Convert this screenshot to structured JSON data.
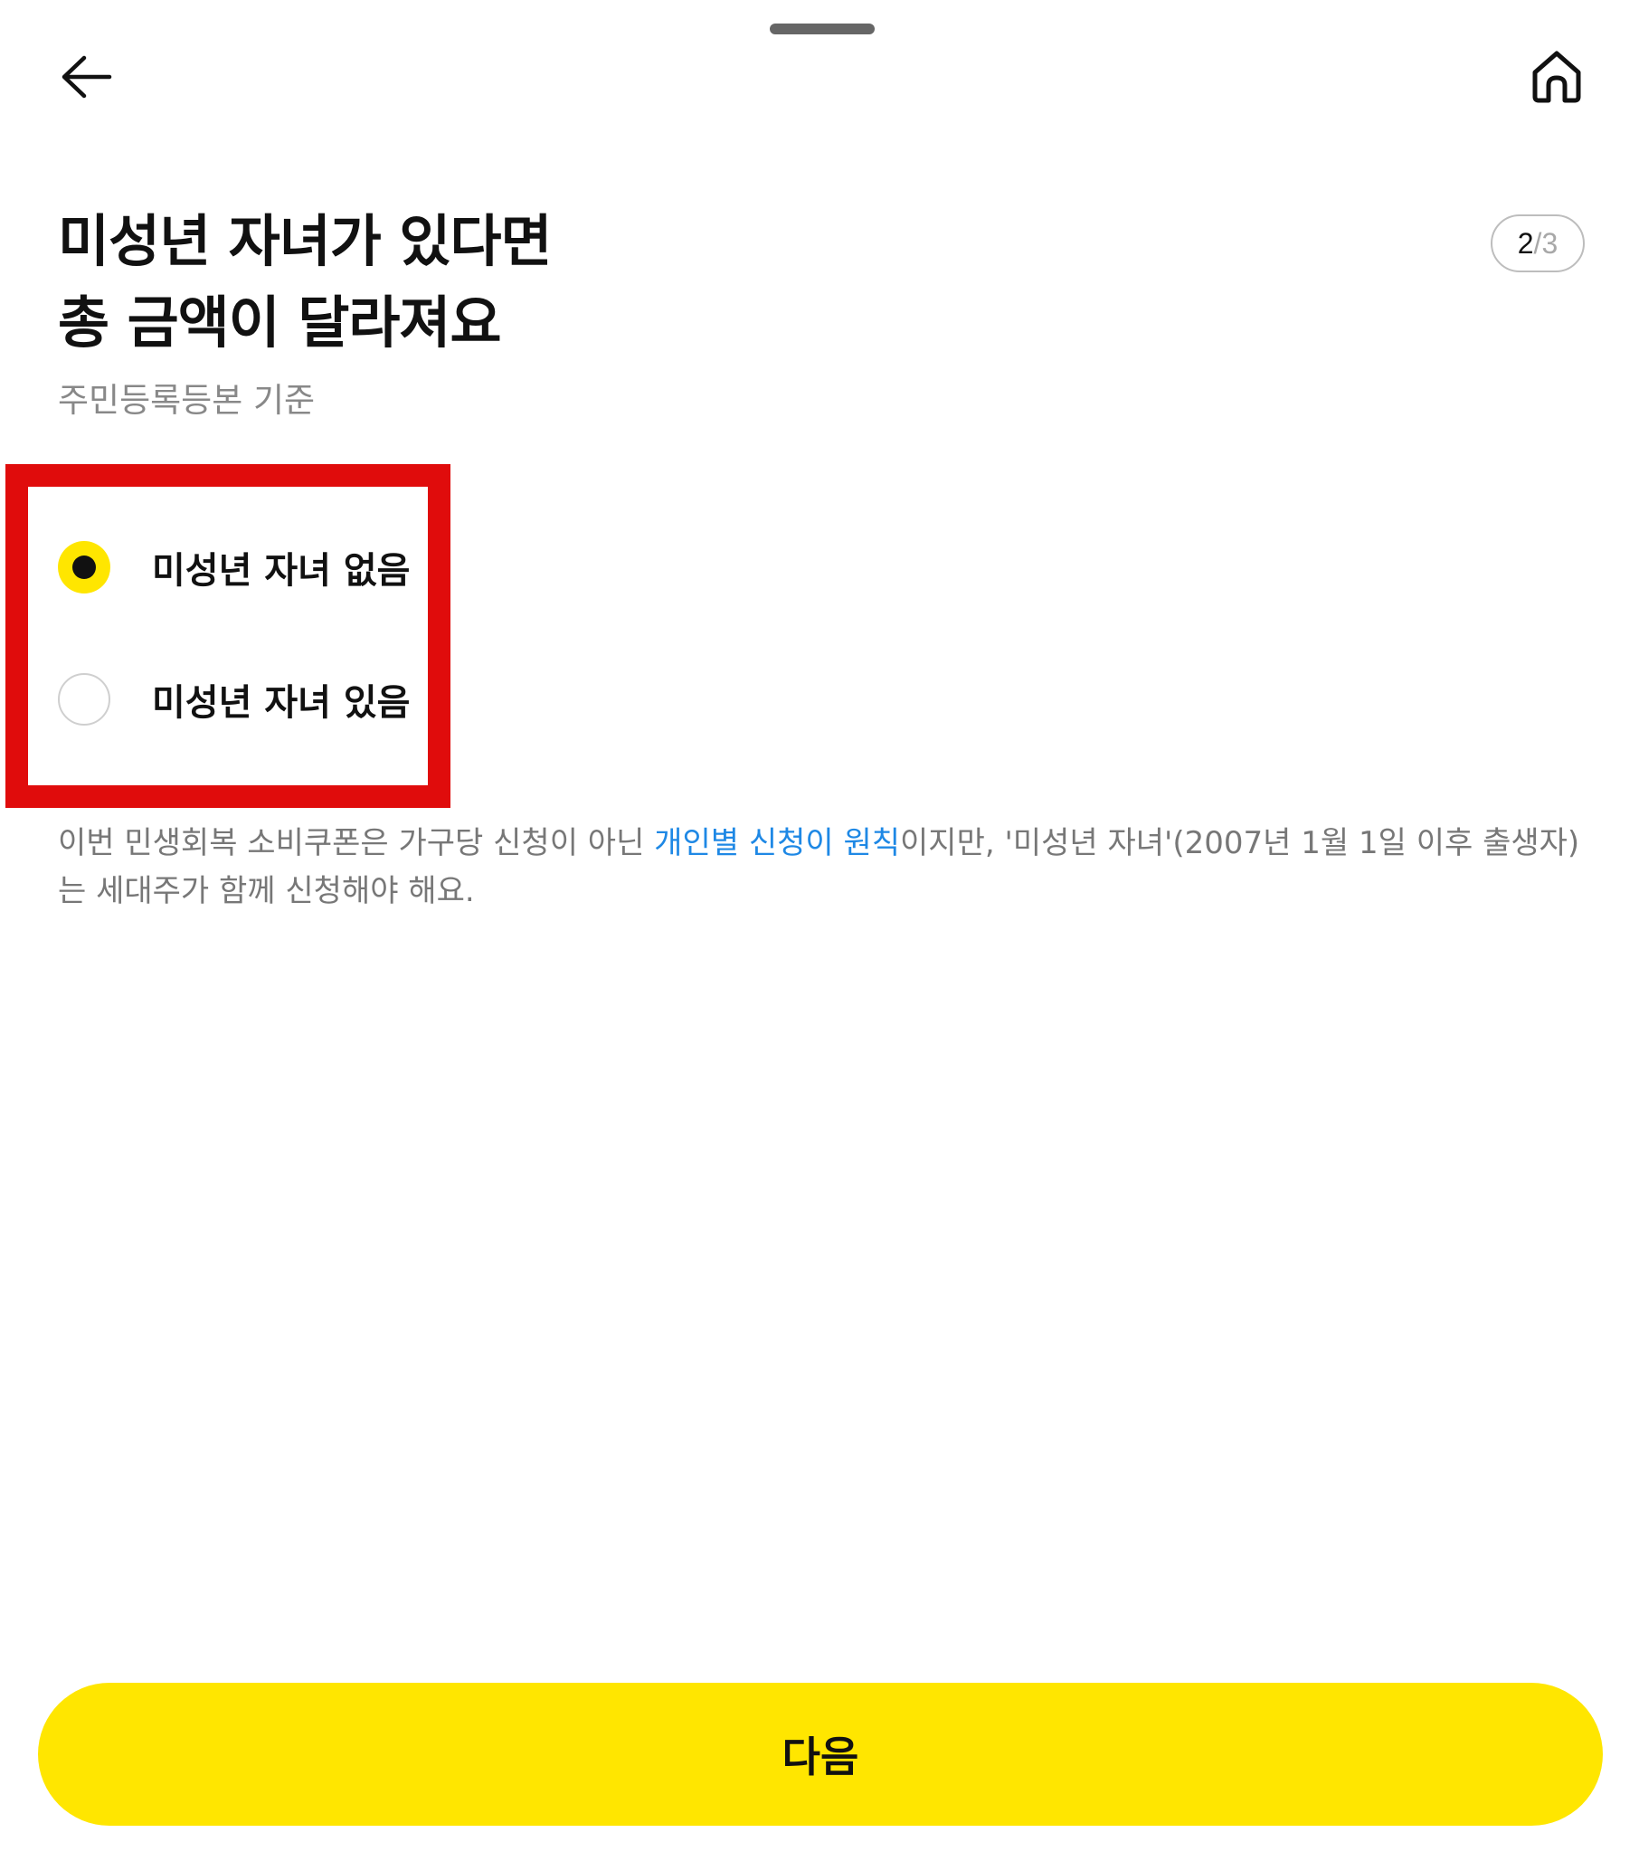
{
  "header": {
    "back_icon": "arrow-left-icon",
    "home_icon": "home-icon"
  },
  "title": {
    "line1": "미성년 자녀가 있다면",
    "line2": "총 금액이 달라져요"
  },
  "step": {
    "current": "2",
    "separator": "/",
    "total": "3"
  },
  "subtitle": "주민등록등본 기준",
  "options": [
    {
      "label": "미성년 자녀 없음",
      "selected": true
    },
    {
      "label": "미성년 자녀 있음",
      "selected": false
    }
  ],
  "notice": {
    "before": "이번 민생회복 소비쿠폰은 가구당 신청이 아닌 ",
    "link": "개인별 신청이 원칙",
    "after": "이지만, '미성년 자녀'(2007년 1월 1일 이후 출생자)는 세대주가 함께 신청해야 해요."
  },
  "next_button": "다음",
  "colors": {
    "accent_yellow": "#ffe600",
    "highlight_red": "#e00c0c",
    "link_blue": "#1e88e5"
  }
}
